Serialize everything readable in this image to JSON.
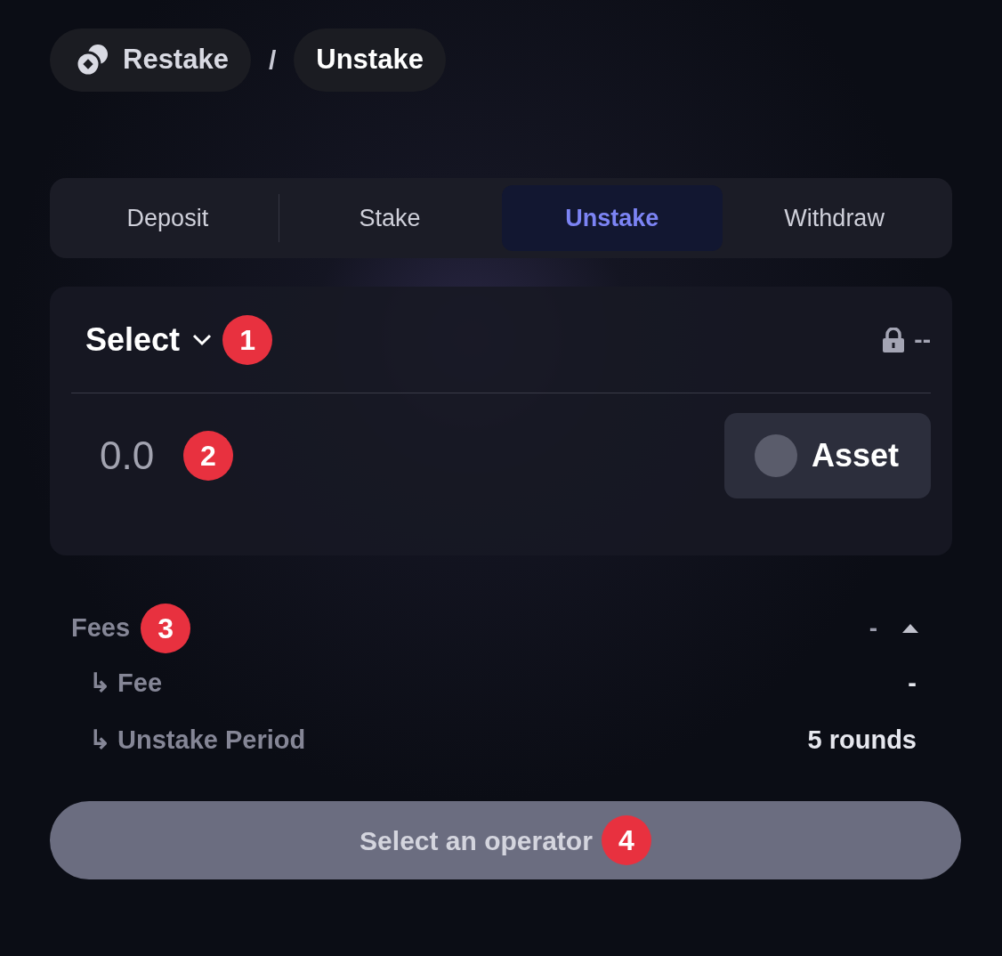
{
  "breadcrumb": [
    {
      "label": "Restake",
      "current": false
    },
    {
      "label": "Unstake",
      "current": true
    }
  ],
  "breadcrumb_separator": "/",
  "tabs": [
    {
      "label": "Deposit",
      "selected": false
    },
    {
      "label": "Stake",
      "selected": false
    },
    {
      "label": "Unstake",
      "selected": true
    },
    {
      "label": "Withdraw",
      "selected": false
    }
  ],
  "operator_select": {
    "label": "Select",
    "marker": "1",
    "balance": "--"
  },
  "amount": {
    "placeholder": "0.0",
    "marker": "2"
  },
  "asset_button": {
    "label": "Asset"
  },
  "fees": {
    "label": "Fees",
    "marker": "3",
    "value": "-",
    "expanded": true,
    "rows": [
      {
        "label": "↳ Fee",
        "value": "-"
      },
      {
        "label": "↳ Unstake Period",
        "value": "5 rounds"
      }
    ]
  },
  "submit_button": {
    "label": "Select an operator",
    "marker": "4",
    "disabled": true
  }
}
